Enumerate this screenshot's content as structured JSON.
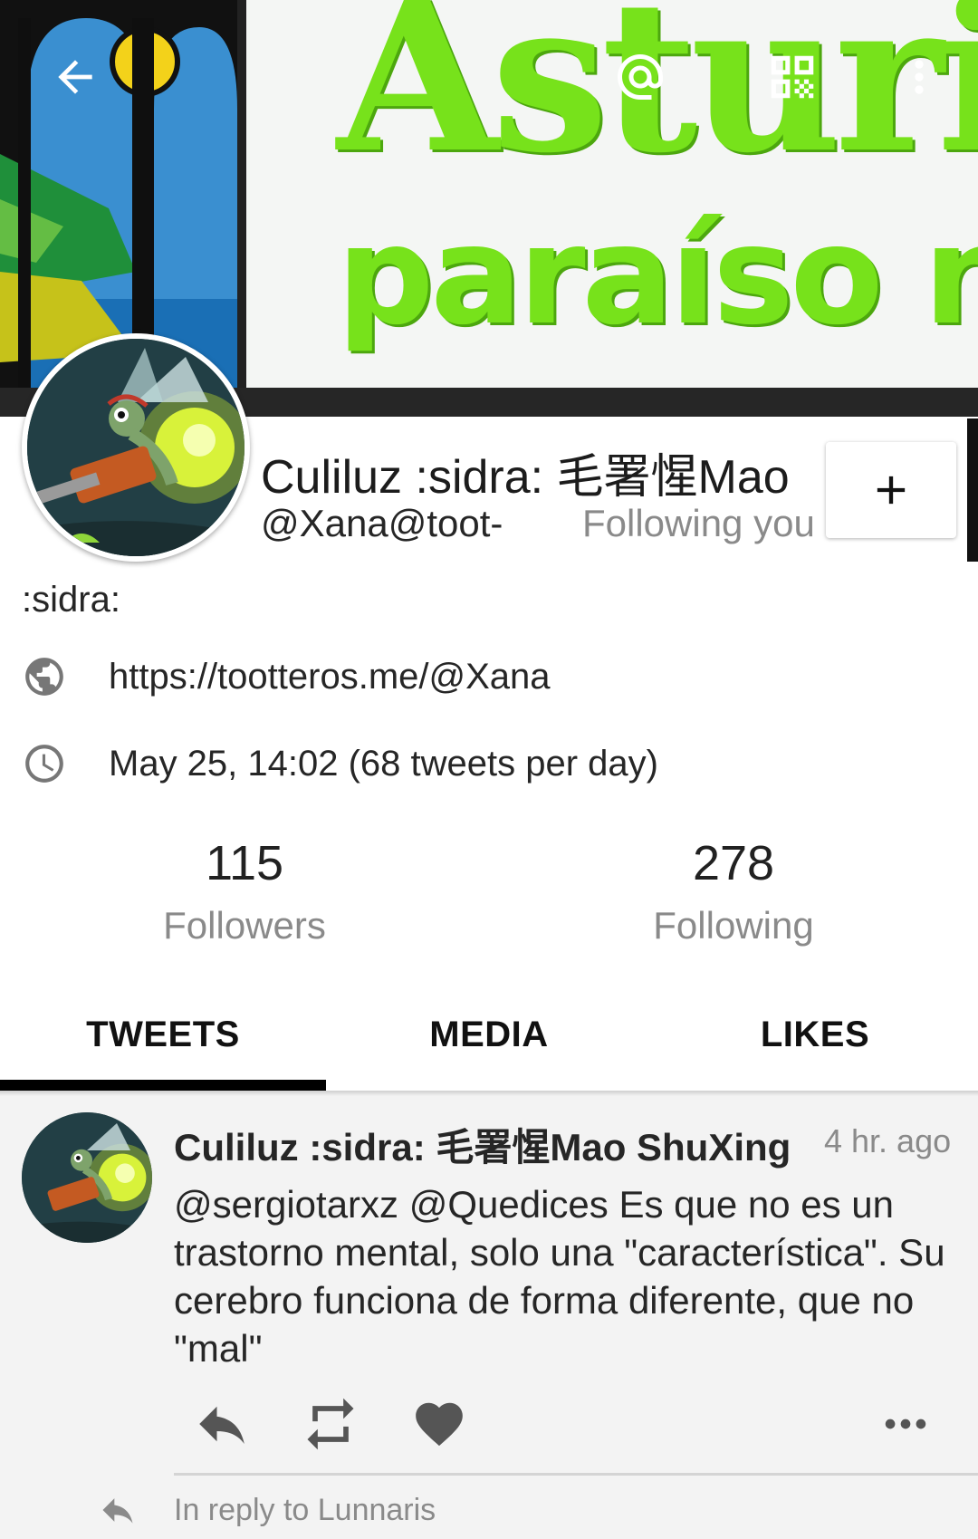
{
  "app": {
    "accent_color": "#000000",
    "banner": {
      "title": "Asturi",
      "subtitle": "paraíso na"
    }
  },
  "topbar": {
    "back_icon": "arrow-back-icon",
    "mention_icon": "at-icon",
    "qr_icon": "qr-code-icon",
    "menu_icon": "more-vert-icon"
  },
  "profile": {
    "display_name": "Culiluz :sidra: 毛署惺Mao",
    "handle": "@Xana@toot-",
    "following_you": "Following you",
    "follow_icon": "plus-icon",
    "bio": ":sidra:",
    "website": "https://tootteros.me/@Xana",
    "joined": "May 25, 14:02 (68 tweets per day)"
  },
  "stats": {
    "followers_count": "115",
    "followers_label": "Followers",
    "following_count": "278",
    "following_label": "Following"
  },
  "tabs": [
    {
      "label": "TWEETS",
      "active": true
    },
    {
      "label": "MEDIA",
      "active": false
    },
    {
      "label": "LIKES",
      "active": false
    }
  ],
  "timeline": {
    "posts": [
      {
        "author": "Culiluz :sidra: 毛署惺Mao ShuXing",
        "time": "4 hr. ago",
        "text": "@sergiotarxz @Quedices Es que no es un trastorno mental, solo una \"característica\". Su cerebro funciona de forma diferente, que no \"mal\"",
        "actions": [
          "reply-icon",
          "retweet-icon",
          "heart-icon",
          "more-horiz-icon"
        ]
      }
    ],
    "next_reply_label": "In reply to Lunnaris"
  }
}
